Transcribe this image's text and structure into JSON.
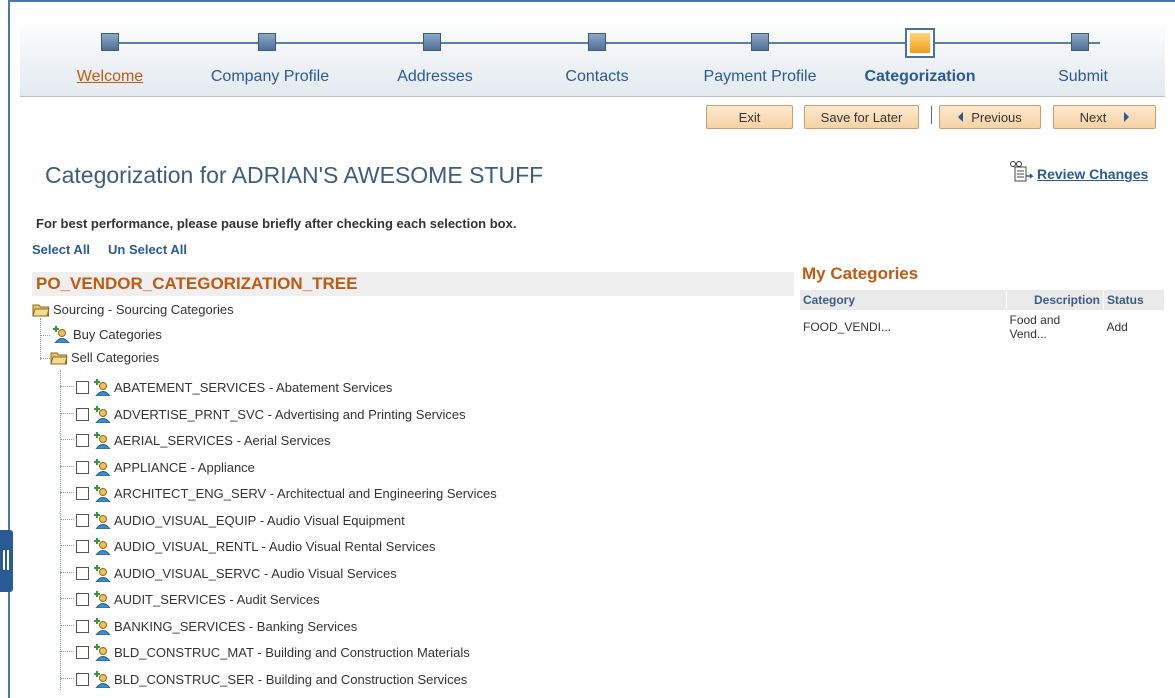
{
  "steps": [
    {
      "label": "Welcome",
      "state": "visited"
    },
    {
      "label": "Company Profile",
      "state": "normal"
    },
    {
      "label": "Addresses",
      "state": "normal"
    },
    {
      "label": "Contacts",
      "state": "normal"
    },
    {
      "label": "Payment Profile",
      "state": "normal"
    },
    {
      "label": "Categorization",
      "state": "active"
    },
    {
      "label": "Submit",
      "state": "normal"
    }
  ],
  "toolbar": {
    "exit": "Exit",
    "save_for_later": "Save for Later",
    "previous": "Previous",
    "next": "Next"
  },
  "page_title": "Categorization for ADRIAN'S AWESOME STUFF",
  "review_changes": "Review Changes",
  "performance_note": "For best performance, please pause briefly after checking each selection box.",
  "select_all": "Select All",
  "unselect_all": "Un Select All",
  "tree": {
    "title": "PO_VENDOR_CATEGORIZATION_TREE",
    "root": "Sourcing - Sourcing Categories",
    "buy": "Buy Categories",
    "sell": "Sell Categories",
    "items": [
      "ABATEMENT_SERVICES - Abatement Services",
      "ADVERTISE_PRNT_SVC - Advertising and Printing Services",
      "AERIAL_SERVICES - Aerial Services",
      "APPLIANCE - Appliance",
      "ARCHITECT_ENG_SERV - Architectual and Engineering Services",
      "AUDIO_VISUAL_EQUIP - Audio Visual Equipment",
      "AUDIO_VISUAL_RENTL - Audio Visual Rental Services",
      "AUDIO_VISUAL_SERVC - Audio Visual Services",
      "AUDIT_SERVICES - Audit Services",
      "BANKING_SERVICES - Banking Services",
      "BLD_CONSTRUC_MAT - Building and Construction Materials",
      "BLD_CONSTRUC_SER - Building and Construction Services"
    ]
  },
  "my_categories": {
    "title": "My Categories",
    "headers": {
      "category": "Category",
      "description": "Description",
      "status": "Status"
    },
    "rows": [
      {
        "category": "FOOD_VENDI...",
        "description": "Food and Vend...",
        "status": "Add"
      }
    ]
  },
  "colors": {
    "accent": "#c05a10",
    "link": "#2a5a94",
    "button": "#f6d2a4"
  }
}
